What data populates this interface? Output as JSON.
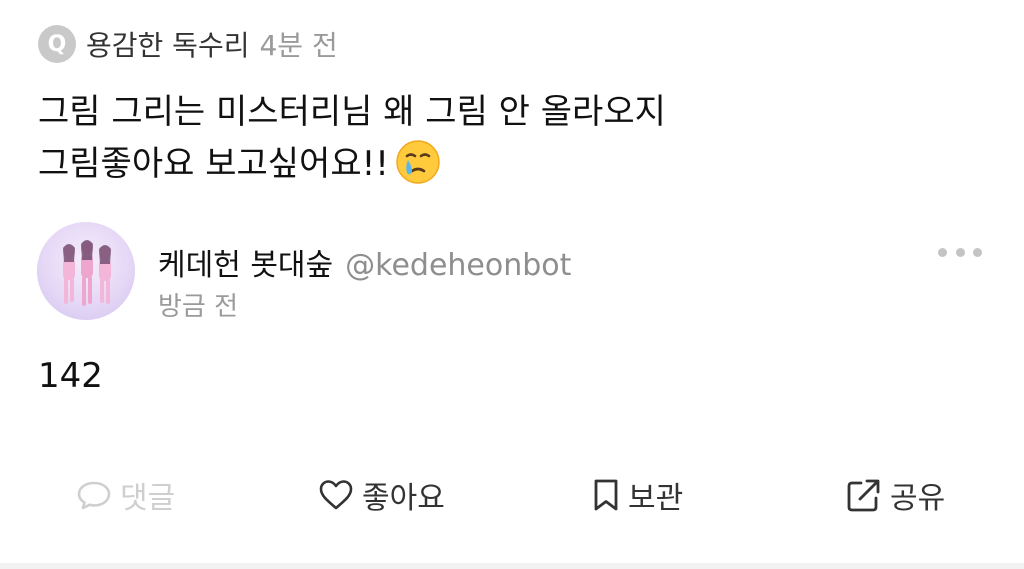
{
  "question": {
    "badge": "Q",
    "author": "용감한 독수리",
    "time": "4분 전",
    "lines": [
      "그림 그리는 미스터리님 왜 그림 안 올라오지",
      "그림좋아요 보고싶어요!!"
    ],
    "emoji": "face-holding-back-tears"
  },
  "answer": {
    "author_name": "케데헌 봇대숲",
    "author_handle": "@kedeheonbot",
    "time": "방금 전",
    "body": "142",
    "more_icon": "more-horizontal-icon"
  },
  "actions": {
    "comment": {
      "label": "댓글",
      "icon": "comment-icon",
      "enabled": false
    },
    "like": {
      "label": "좋아요",
      "icon": "heart-icon"
    },
    "save": {
      "label": "보관",
      "icon": "bookmark-icon"
    },
    "share": {
      "label": "공유",
      "icon": "share-icon"
    }
  },
  "colors": {
    "badge": "#c9c9c9",
    "muted": "#9a9a9a",
    "disabled": "#cfcfcf",
    "text": "#111111"
  }
}
